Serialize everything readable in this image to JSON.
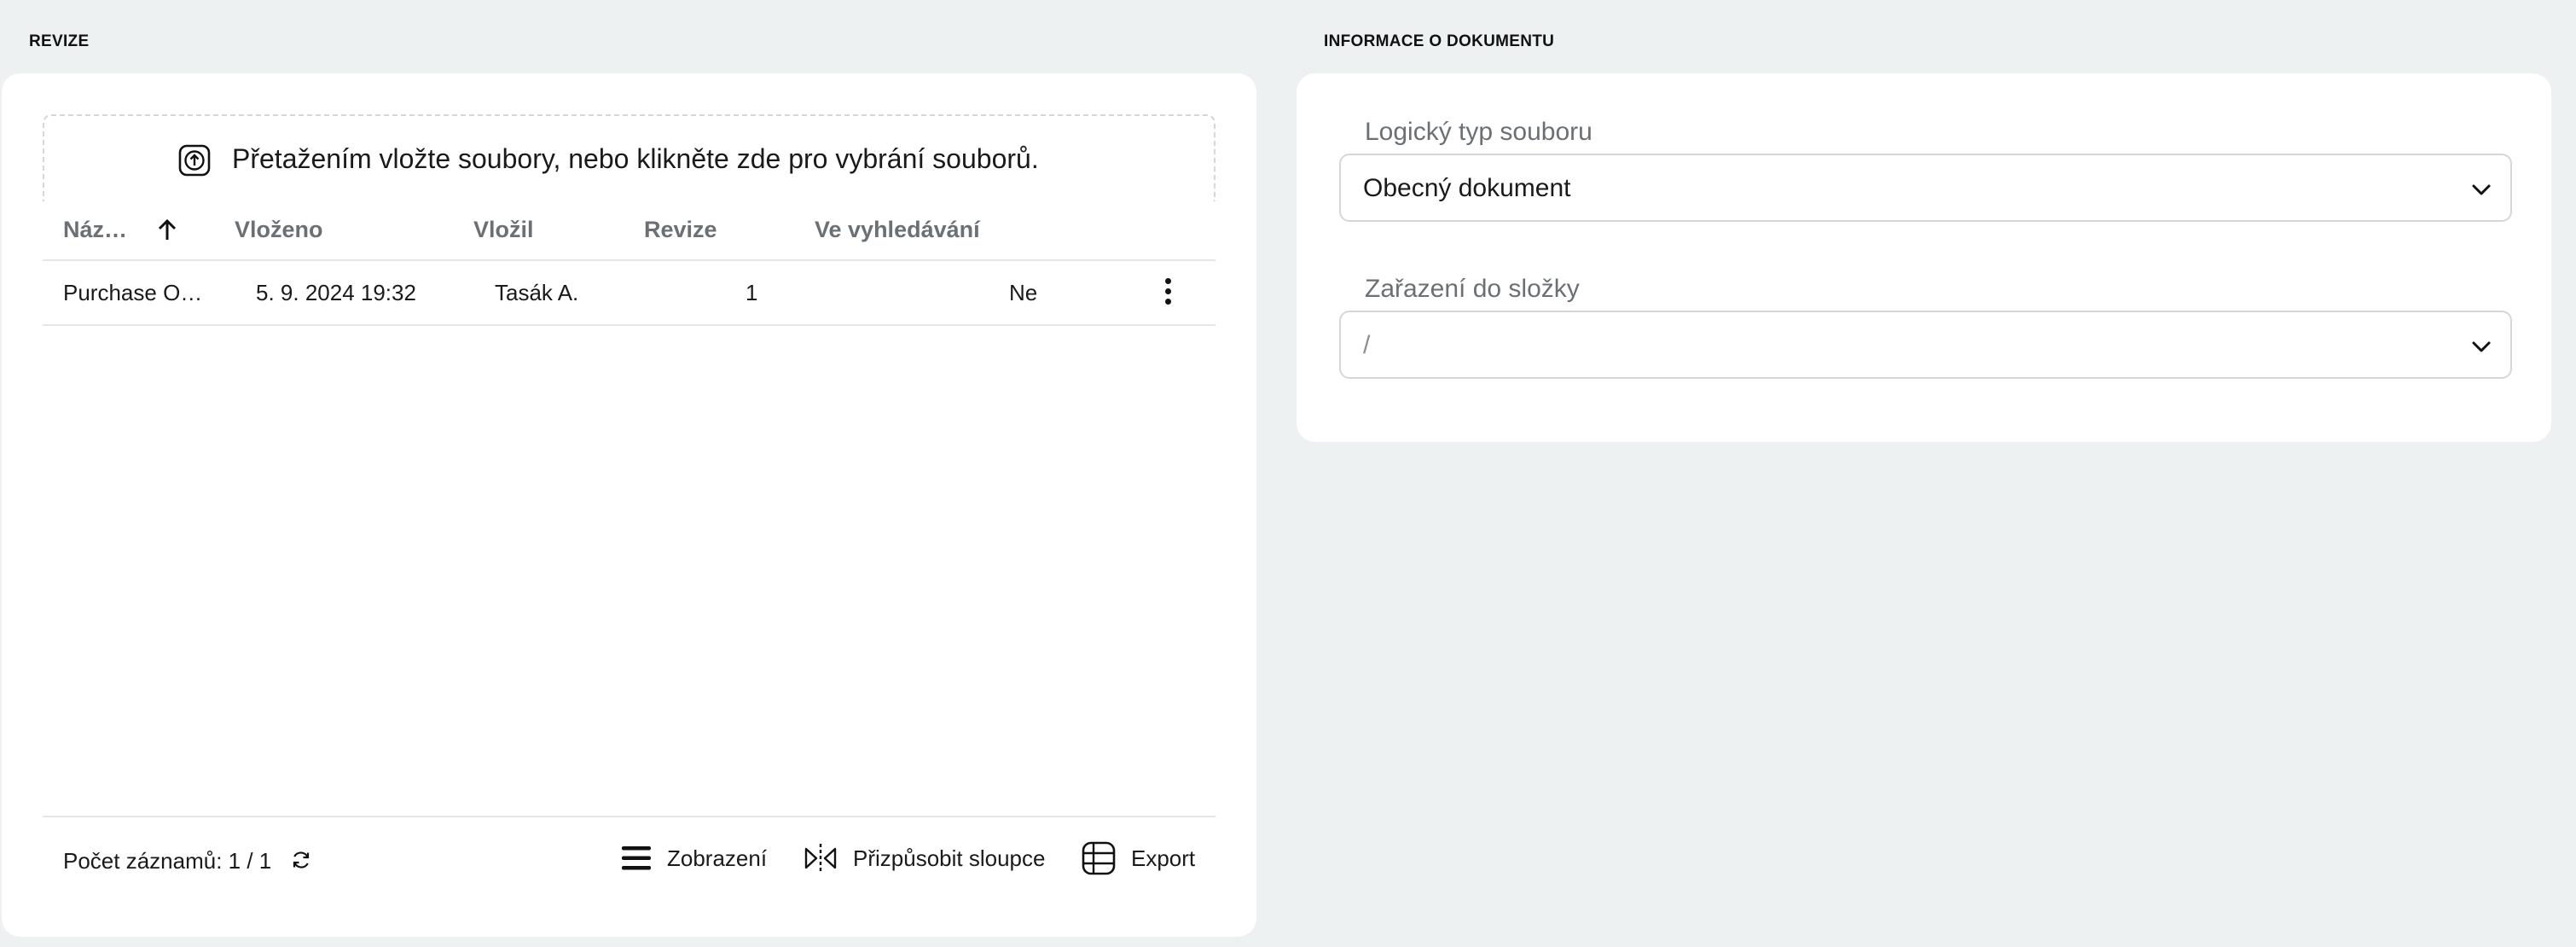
{
  "revize": {
    "section_title": "REVIZE",
    "upload": {
      "icon": "upload-icon",
      "text": "Přetažením vložte soubory, nebo klikněte zde pro vybrání souborů."
    },
    "table": {
      "columns": [
        "Náz…",
        "Vloženo",
        "Vložil",
        "Revize",
        "Ve vyhledávání"
      ],
      "sort_icon": "arrow-up-icon",
      "rows": [
        {
          "name": "Purchase O…",
          "inserted": "5. 9. 2024 19:32",
          "inserted_by": "Tasák A.",
          "revision": "1",
          "in_search": "Ne"
        }
      ]
    },
    "footer": {
      "count": "Počet záznamů: 1 / 1",
      "refresh_icon": "refresh-icon",
      "view_label": "Zobrazení",
      "fit_columns_label": "Přizpůsobit sloupce",
      "export_label": "Export"
    }
  },
  "document_info": {
    "section_title": "INFORMACE O DOKUMENTU",
    "logical_type": {
      "label": "Logický typ souboru",
      "value": "Obecný dokument"
    },
    "folder": {
      "label": "Zařazení do složky",
      "value": "/"
    }
  },
  "colors": {
    "background": "#eef1f2",
    "card": "#ffffff",
    "header_text": "#6b7075",
    "border": "#d3d7da"
  }
}
